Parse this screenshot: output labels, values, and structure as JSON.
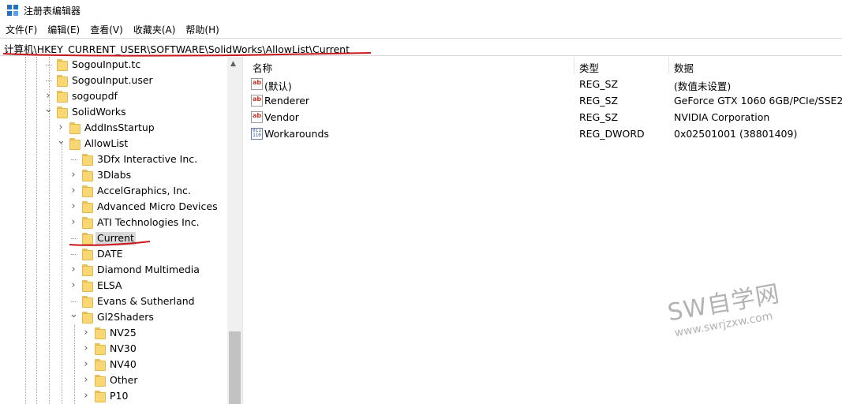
{
  "window": {
    "title": "注册表编辑器"
  },
  "menu": [
    "文件(F)",
    "编辑(E)",
    "查看(V)",
    "收藏夹(A)",
    "帮助(H)"
  ],
  "address": "计算机\\HKEY_CURRENT_USER\\SOFTWARE\\SolidWorks\\AllowList\\Current",
  "tree": {
    "items": [
      {
        "label": "SogouInput.tc",
        "expander": ""
      },
      {
        "label": "SogouInput.user",
        "expander": ""
      },
      {
        "label": "sogoupdf",
        "expander": "›"
      },
      {
        "label": "SolidWorks",
        "expander": "⌄"
      },
      {
        "label": "AddInsStartup",
        "expander": "›"
      },
      {
        "label": "AllowList",
        "expander": "⌄"
      },
      {
        "label": "3Dfx Interactive Inc.",
        "expander": ""
      },
      {
        "label": "3Dlabs",
        "expander": "›"
      },
      {
        "label": "AccelGraphics, Inc.",
        "expander": "›"
      },
      {
        "label": "Advanced Micro Devices",
        "expander": "›"
      },
      {
        "label": "ATI Technologies Inc.",
        "expander": "›"
      },
      {
        "label": "Current",
        "expander": ""
      },
      {
        "label": "DATE",
        "expander": ""
      },
      {
        "label": "Diamond Multimedia",
        "expander": "›"
      },
      {
        "label": "ELSA",
        "expander": "›"
      },
      {
        "label": "Evans & Sutherland",
        "expander": ""
      },
      {
        "label": "Gl2Shaders",
        "expander": "⌄"
      },
      {
        "label": "NV25",
        "expander": "›"
      },
      {
        "label": "NV30",
        "expander": "›"
      },
      {
        "label": "NV40",
        "expander": "›"
      },
      {
        "label": "Other",
        "expander": "›"
      },
      {
        "label": "P10",
        "expander": "›"
      }
    ]
  },
  "values": {
    "headers": {
      "name": "名称",
      "type": "类型",
      "data": "数据"
    },
    "rows": [
      {
        "icon": "string-value-icon",
        "glyph": "ab",
        "name": "(默认)",
        "type": "REG_SZ",
        "data": "(数值未设置)"
      },
      {
        "icon": "string-value-icon",
        "glyph": "ab",
        "name": "Renderer",
        "type": "REG_SZ",
        "data": "GeForce GTX 1060 6GB/PCIe/SSE2"
      },
      {
        "icon": "string-value-icon",
        "glyph": "ab",
        "name": "Vendor",
        "type": "REG_SZ",
        "data": "NVIDIA Corporation"
      },
      {
        "icon": "binary-value-icon",
        "glyph": "011 110",
        "name": "Workarounds",
        "type": "REG_DWORD",
        "data": "0x02501001 (38801409)"
      }
    ]
  },
  "watermark": {
    "big": "SW自学网",
    "small": "www.swrjzxw.com"
  },
  "colors": {
    "annotation": "#c8181e",
    "folder": "#f8d775",
    "selection": "#d9d9d9"
  }
}
